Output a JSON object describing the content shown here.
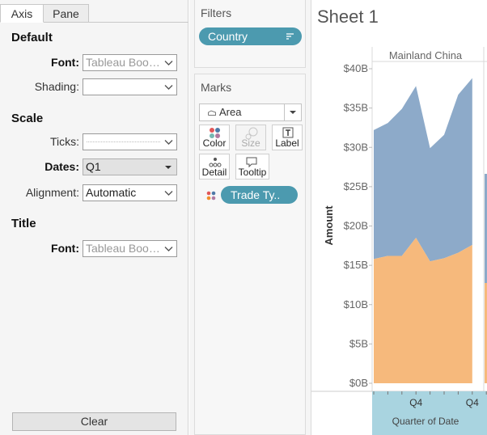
{
  "format_pane": {
    "tabs": [
      "Axis",
      "Pane"
    ],
    "sections": {
      "default": "Default",
      "scale": "Scale",
      "title": "Title"
    },
    "fields": {
      "font_label": "Font:",
      "font_value": "Tableau Book,...",
      "shading_label": "Shading:",
      "shading_value": "",
      "ticks_label": "Ticks:",
      "dates_label": "Dates:",
      "dates_value": "Q1",
      "alignment_label": "Alignment:",
      "alignment_value": "Automatic",
      "title_font_label": "Font:",
      "title_font_value": "Tableau Book,..."
    },
    "clear_label": "Clear"
  },
  "filters": {
    "title": "Filters",
    "pill": "Country"
  },
  "marks": {
    "title": "Marks",
    "mark_type": "Area",
    "buttons": {
      "color": "Color",
      "size": "Size",
      "label": "Label",
      "detail": "Detail",
      "tooltip": "Tooltip"
    },
    "color_pill": "Trade Ty.."
  },
  "sheet": {
    "title": "Sheet 1"
  },
  "colors": {
    "pill_teal": "#4c9aaf",
    "series_blue": "#8daac9",
    "series_orange": "#f6b97c",
    "x_header_bg": "#a9d4e0"
  },
  "chart_data": {
    "type": "area",
    "pane_header": "Mainland China",
    "ylabel": "Amount",
    "xlabel": "Quarter of Date",
    "ylim": [
      0,
      40
    ],
    "y_ticks": [
      "$0B",
      "$5B",
      "$10B",
      "$15B",
      "$20B",
      "$25B",
      "$30B",
      "$35B",
      "$40B"
    ],
    "y_tick_values": [
      0,
      5,
      10,
      15,
      20,
      25,
      30,
      35,
      40
    ],
    "x_tick_labels": [
      "Q4",
      "Q4"
    ],
    "x_tick_indices": [
      4,
      8
    ],
    "x": [
      1,
      2,
      3,
      4,
      5,
      6,
      7,
      8,
      9
    ],
    "series": [
      {
        "values": [
          15.8,
          16.2,
          16.2,
          18.5,
          15.5,
          15.9,
          16.6,
          17.6
        ]
      },
      {
        "values": [
          16.4,
          16.9,
          18.7,
          19.3,
          14.4,
          15.7,
          20.1,
          21.2
        ]
      }
    ],
    "stacked": true
  }
}
